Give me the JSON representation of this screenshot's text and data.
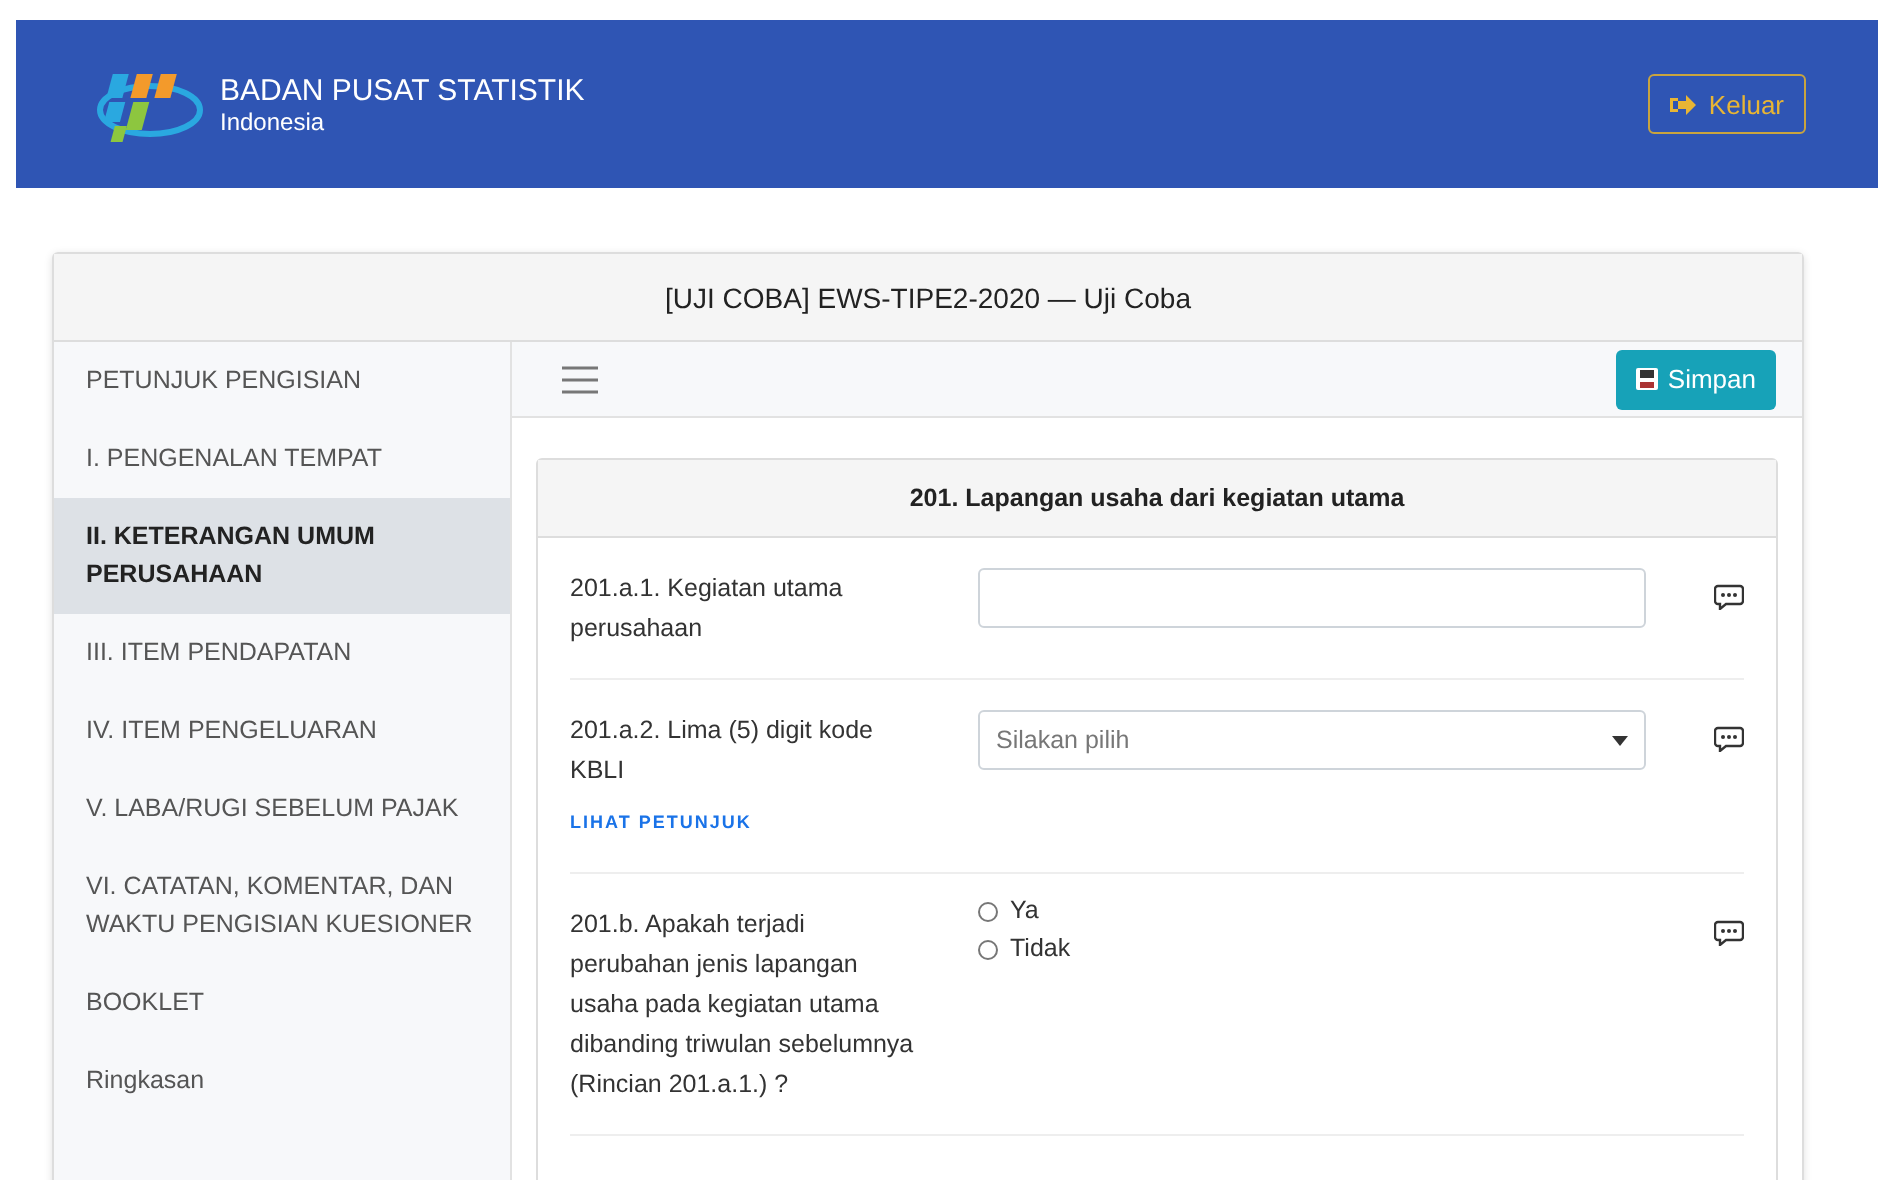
{
  "header": {
    "org": "BADAN PUSAT STATISTIK",
    "country": "Indonesia",
    "logout": "Keluar"
  },
  "title": "[UJI COBA] EWS-TIPE2-2020 — Uji Coba",
  "sidebar": {
    "items": [
      {
        "label": "PETUNJUK PENGISIAN",
        "selected": false
      },
      {
        "label": "I. PENGENALAN TEMPAT",
        "selected": false
      },
      {
        "label": "II. KETERANGAN UMUM PERUSAHAAN",
        "selected": true
      },
      {
        "label": "III. ITEM PENDAPATAN",
        "selected": false
      },
      {
        "label": "IV. ITEM PENGELUARAN",
        "selected": false
      },
      {
        "label": "V. LABA/RUGI SEBELUM PAJAK",
        "selected": false
      },
      {
        "label": "VI. CATATAN, KOMENTAR, DAN WAKTU PENGISIAN KUESIONER",
        "selected": false
      },
      {
        "label": "BOOKLET",
        "selected": false
      },
      {
        "label": "Ringkasan",
        "selected": false
      }
    ]
  },
  "toolbar": {
    "save": "Simpan"
  },
  "section": {
    "title": "201. Lapangan usaha dari kegiatan utama",
    "questions": [
      {
        "kind": "text",
        "label": "201.a.1. Kegiatan utama perusahaan"
      },
      {
        "kind": "select",
        "label": "201.a.2. Lima (5) digit kode KBLI",
        "hint_link": "LIHAT PETUNJUK",
        "placeholder": "Silakan pilih"
      },
      {
        "kind": "radio",
        "label": "201.b. Apakah terjadi perubahan jenis lapangan usaha pada kegiatan utama dibanding triwulan sebelumnya (Rincian 201.a.1.) ?",
        "options": [
          {
            "label": "Ya",
            "selected": false
          },
          {
            "label": "Tidak",
            "selected": false
          }
        ]
      }
    ]
  }
}
